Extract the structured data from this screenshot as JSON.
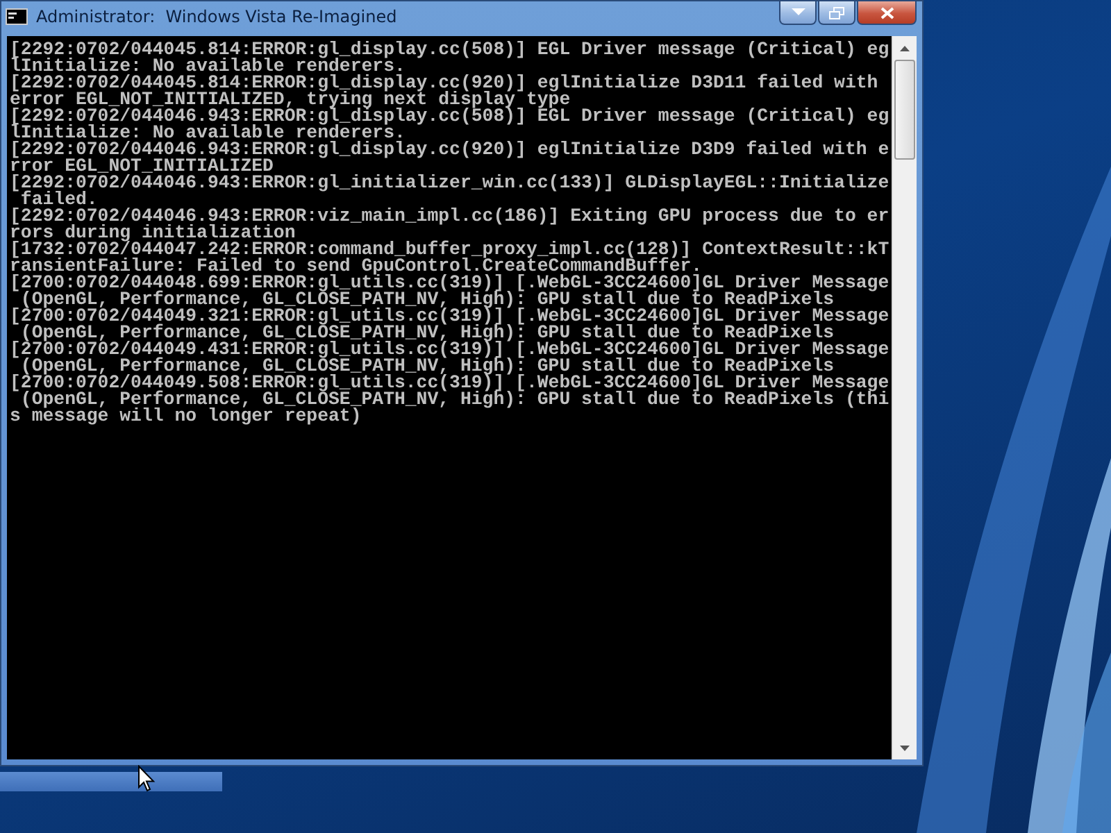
{
  "window": {
    "title": "Administrator:  Windows Vista Re-Imagined"
  },
  "console": {
    "lines": [
      "[2292:0702/044045.814:ERROR:gl_display.cc(508)] EGL Driver message (Critical) eg",
      "lInitialize: No available renderers.",
      "[2292:0702/044045.814:ERROR:gl_display.cc(920)] eglInitialize D3D11 failed with",
      "error EGL_NOT_INITIALIZED, trying next display type",
      "[2292:0702/044046.943:ERROR:gl_display.cc(508)] EGL Driver message (Critical) eg",
      "lInitialize: No available renderers.",
      "[2292:0702/044046.943:ERROR:gl_display.cc(920)] eglInitialize D3D9 failed with e",
      "rror EGL_NOT_INITIALIZED",
      "[2292:0702/044046.943:ERROR:gl_initializer_win.cc(133)] GLDisplayEGL::Initialize",
      " failed.",
      "[2292:0702/044046.943:ERROR:viz_main_impl.cc(186)] Exiting GPU process due to er",
      "rors during initialization",
      "[1732:0702/044047.242:ERROR:command_buffer_proxy_impl.cc(128)] ContextResult::kT",
      "ransientFailure: Failed to send GpuControl.CreateCommandBuffer.",
      "[2700:0702/044048.699:ERROR:gl_utils.cc(319)] [.WebGL-3CC24600]GL Driver Message",
      " (OpenGL, Performance, GL_CLOSE_PATH_NV, High): GPU stall due to ReadPixels",
      "[2700:0702/044049.321:ERROR:gl_utils.cc(319)] [.WebGL-3CC24600]GL Driver Message",
      " (OpenGL, Performance, GL_CLOSE_PATH_NV, High): GPU stall due to ReadPixels",
      "[2700:0702/044049.431:ERROR:gl_utils.cc(319)] [.WebGL-3CC24600]GL Driver Message",
      " (OpenGL, Performance, GL_CLOSE_PATH_NV, High): GPU stall due to ReadPixels",
      "[2700:0702/044049.508:ERROR:gl_utils.cc(319)] [.WebGL-3CC24600]GL Driver Message",
      " (OpenGL, Performance, GL_CLOSE_PATH_NV, High): GPU stall due to ReadPixels (thi",
      "s message will no longer repeat)"
    ]
  }
}
